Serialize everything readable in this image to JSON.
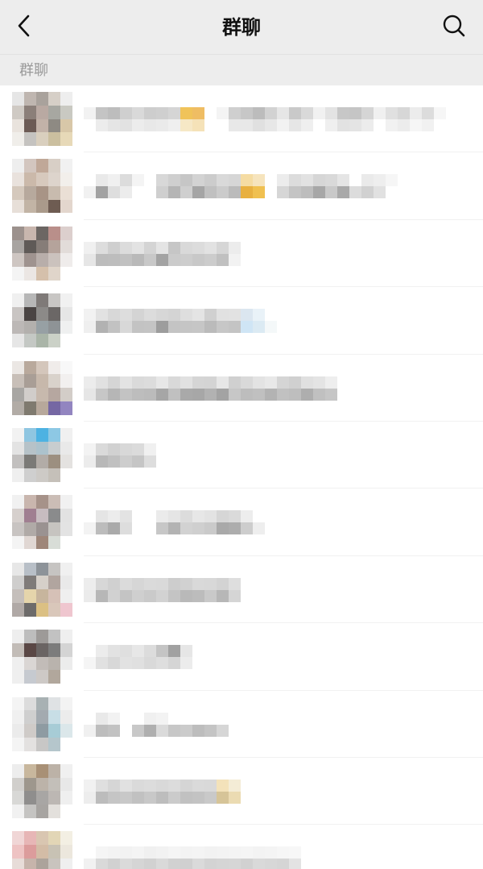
{
  "navbar": {
    "title": "群聊",
    "back_icon": "chevron-left-icon",
    "search_icon": "search-icon"
  },
  "section": {
    "label": "群聊"
  },
  "colors": {
    "navbar_bg": "#ededed",
    "list_bg": "#ffffff",
    "section_text": "#9a9a9a",
    "title_text": "#111111"
  },
  "groups": [
    {
      "avatar": [
        "#e6e6e6",
        "#bfb6b0",
        "#a9a29c",
        "#d6cfc7",
        "#eeeeee",
        "#cfcac4",
        "#8b7f79",
        "#b9a9a2",
        "#a7a7a1",
        "#c9c9c2",
        "#e9e3dd",
        "#6c5b55",
        "#c2b2a8",
        "#8e8a83",
        "#d8c7a8",
        "#f0eeea",
        "#c5c3c0",
        "#d9cfbe",
        "#cbbf9f",
        "#e7d9b8"
      ],
      "name_blocks": [
        [
          "#f2f2f2",
          "#c4c4c4",
          "#bdbdbd",
          "#cfcfcf",
          "#d9d9d9",
          "#cdcdcd",
          "#cfcfcf",
          "#d5d5d5",
          "#f0c35a",
          "#efbd63",
          "#ffffff",
          "#f4f4f4",
          "#cfcfcf",
          "#c7c7c7",
          "#bcbcbc",
          "#d2d2d2",
          "#e6e6e6",
          "#c9c9c9",
          "#d9d9d9",
          "#f1f1f1",
          "#e3e3e3",
          "#c7c7c7",
          "#c5c5c5",
          "#d5d5d5",
          "#f0f0f0",
          "#e0e0e0",
          "#d7d7d7",
          "#ececec",
          "#dcdcdc",
          "#f6f6f6"
        ],
        [
          "#ffffff",
          "#ececec",
          "#e5e5e5",
          "#e2e2e2",
          "#ececec",
          "#e8e8e8",
          "#eaeaea",
          "#efefef",
          "#f6e8c6",
          "#f5e2b8",
          "#ffffff",
          "#ffffff",
          "#e8e8e8",
          "#e8e8e8",
          "#e0e0e0",
          "#e7e7e7",
          "#f2f2f2",
          "#e6e6e6",
          "#efefef",
          "#ffffff",
          "#efefef",
          "#e2e2e2",
          "#e4e4e4",
          "#ececec",
          "#ffffff",
          "#f1f1f1",
          "#ececec",
          "#f6f6f6",
          "#f1f1f1",
          "#ffffff"
        ]
      ]
    },
    {
      "avatar": [
        "#eeeeee",
        "#d3c6bf",
        "#c0a898",
        "#d8cfc6",
        "#f1f1f1",
        "#e9e2dd",
        "#cbb9aa",
        "#d7c9bd",
        "#ddd4cc",
        "#f2efeb",
        "#d5c9bd",
        "#b7a99d",
        "#a89486",
        "#c8bbae",
        "#eadfd5",
        "#e7dfd8",
        "#c2b4a5",
        "#aa9a8b",
        "#6e5c52",
        "#e3d6cd"
      ],
      "name_blocks": [
        [
          "#ffffff",
          "#e9e9e9",
          "#f0f0f0",
          "#dcdcdc",
          "#f4f4f4",
          "#ffffff",
          "#d8d8d8",
          "#cfcfcf",
          "#c6c6c6",
          "#d3d3d3",
          "#cccccc",
          "#d9d9d9",
          "#d6d6d6",
          "#f5dca3",
          "#f6e4bd",
          "#ffffff",
          "#ececec",
          "#dcdcdc",
          "#e2e2e2",
          "#d6d6d6",
          "#d9d9d9",
          "#e5e5e5",
          "#ffffff",
          "#eaeaea",
          "#eeeeee",
          "#f6f6f6",
          "#ffffff",
          "#ffffff",
          "#ffffff",
          "#ffffff"
        ],
        [
          "#f1f1f1",
          "#a2a2a2",
          "#dedede",
          "#ececec",
          "#ffffff",
          "#ffffff",
          "#cfcfcf",
          "#b5b5b5",
          "#cfcfcf",
          "#a5a5a5",
          "#c0c0c0",
          "#cbcbcb",
          "#bbbbbb",
          "#e8b040",
          "#f0c050",
          "#ffffff",
          "#d6d6d6",
          "#c4c4c4",
          "#bdbdbd",
          "#a7a7a7",
          "#c9c9c9",
          "#a9a9a9",
          "#dcdcdc",
          "#d1d1d1",
          "#e1e1e1",
          "#ffffff",
          "#ffffff",
          "#ffffff",
          "#ffffff",
          "#ffffff"
        ]
      ]
    },
    {
      "avatar": [
        "#9c918d",
        "#c8b6ae",
        "#6c6663",
        "#b98f8a",
        "#dccfcd",
        "#a8a4a1",
        "#5f5a57",
        "#867d78",
        "#b5a39b",
        "#e2dcd9",
        "#cec6c2",
        "#9f938f",
        "#b8aeaa",
        "#cbc2bd",
        "#efeceb",
        "#f4f4f4",
        "#ebe6e3",
        "#d5c0ab",
        "#e0d5ca",
        "#ffffff"
      ],
      "name_blocks": [
        [
          "#f0f0f0",
          "#dddddd",
          "#cfcfcf",
          "#dcdcdc",
          "#e3e3e3",
          "#d4d4d4",
          "#e4e4e4",
          "#c6c6c6",
          "#d9d9d9",
          "#dcdcdc",
          "#e2e2e2",
          "#d6d6d6",
          "#ececec",
          "#ffffff"
        ],
        [
          "#e6e6e6",
          "#bcbcbc",
          "#bdbdbd",
          "#c1c1c1",
          "#b9b9b9",
          "#c8c8c8",
          "#a3a3a3",
          "#cbcbcb",
          "#cdcdcd",
          "#c8c8c8",
          "#cccccc",
          "#c0c0c0",
          "#f2f2f2",
          "#ffffff"
        ]
      ]
    },
    {
      "avatar": [
        "#f0f0f0",
        "#b7b7b7",
        "#7f7a78",
        "#c8c6c4",
        "#f1f1f1",
        "#c9c5c3",
        "#4a4443",
        "#8c8a88",
        "#6b6766",
        "#e6e6e6",
        "#bcb8b6",
        "#b3b0ad",
        "#97a0a4",
        "#8e9396",
        "#eff0f0",
        "#e6e6e6",
        "#c4c8c4",
        "#aab5a8",
        "#cbd1c7",
        "#ffffff"
      ],
      "name_blocks": [
        [
          "#f2f2f2",
          "#e2e2e2",
          "#d8d8d8",
          "#dddddd",
          "#d4d4d4",
          "#dcdcdc",
          "#d7d7d7",
          "#d4d4d4",
          "#dedede",
          "#e4e4e4",
          "#d0d0d0",
          "#e1e1e1",
          "#e2e2e2",
          "#dbe6f0",
          "#e9f2f8",
          "#ffffff"
        ],
        [
          "#efefef",
          "#b2b2b2",
          "#c2c2c2",
          "#d8d8d8",
          "#c3c3c3",
          "#c4c4c4",
          "#9d9d9d",
          "#c4c4c4",
          "#c5c5c5",
          "#c6c6c6",
          "#bbbbbb",
          "#c7c7c7",
          "#c4c4c4",
          "#cfe5f5",
          "#dbeaf3",
          "#f4f8f9"
        ]
      ]
    },
    {
      "avatar": [
        "#ebe7e4",
        "#b9a99c",
        "#d4c6bb",
        "#f0ecea",
        "#f8f8f8",
        "#c8bfb8",
        "#a99e96",
        "#c7b8ab",
        "#d9d2cb",
        "#f2f0ef",
        "#a8a6a3",
        "#d1cdca",
        "#c7b9ad",
        "#b6a7a0",
        "#d3cdc8",
        "#b2aca6",
        "#7f7a6f",
        "#b7a89b",
        "#7567a3",
        "#9285c0"
      ],
      "name_blocks": [
        [
          "#ececec",
          "#e1e1e1",
          "#d5d5d5",
          "#e3e3e3",
          "#dadada",
          "#dcdcdc",
          "#e7e7e7",
          "#d9d9d9",
          "#e1e1e1",
          "#d5d5d5",
          "#d4d4d4",
          "#e7e7e7",
          "#d0d0d0",
          "#d9d9d9",
          "#e3e3e3",
          "#e8e8e8",
          "#d5d5d5",
          "#d0d0d0",
          "#e0e0e0",
          "#e4e4e4",
          "#eeeeee"
        ],
        [
          "#e6e6e6",
          "#c7c7c7",
          "#b6b6b6",
          "#c3c3c3",
          "#bdbdbd",
          "#bbbbbb",
          "#a6a6a6",
          "#c0c0c0",
          "#a9a9a9",
          "#a7a7a7",
          "#b2b2b2",
          "#a3a3a3",
          "#c7c7c7",
          "#bdbdbd",
          "#c0c0c0",
          "#b3b3b3",
          "#c1c1c1",
          "#bebebe",
          "#aeaeae",
          "#c0c0c0",
          "#c6c6c6"
        ]
      ]
    },
    {
      "avatar": [
        "#f2f2f2",
        "#8fc6e1",
        "#4db2e2",
        "#8dc8e4",
        "#f0f0f0",
        "#e3e3e3",
        "#b6c2c8",
        "#acc2cc",
        "#c8cdcf",
        "#e9e9e9",
        "#c2c0bf",
        "#7b7a77",
        "#b2aca7",
        "#9c8f80",
        "#e4e2e0",
        "#efefef",
        "#cfcfcf",
        "#cdcac6",
        "#c5c0b9",
        "#ffffff"
      ],
      "name_blocks": [
        [
          "#f3f3f3",
          "#dadada",
          "#d1d1d1",
          "#d8d8d8",
          "#dbdbdb",
          "#f0f0f0"
        ],
        [
          "#ececec",
          "#b8b8b8",
          "#c0c0c0",
          "#cdcdcd",
          "#c5c5c5",
          "#dddddd"
        ]
      ]
    },
    {
      "avatar": [
        "#f1f1f1",
        "#c9b6ae",
        "#a69289",
        "#cbbdb6",
        "#f1f1f1",
        "#d6d0cd",
        "#a07f91",
        "#c7bcc0",
        "#8a8b8c",
        "#e2e2e2",
        "#c8c4c2",
        "#b0aaa7",
        "#9a9291",
        "#c6c4c0",
        "#e3e3e3",
        "#f4f4f4",
        "#e0d7d3",
        "#9e8679",
        "#d8ddd7",
        "#ffffff"
      ],
      "name_blocks": [
        [
          "#ffffff",
          "#e5e5e5",
          "#ececec",
          "#e3e3e3",
          "#ffffff",
          "#ffffff",
          "#ebebeb",
          "#e5e5e5",
          "#dcdcdc",
          "#e7e7e7",
          "#e3e3e3",
          "#d6d6d6",
          "#dadada",
          "#ededed",
          "#ffffff"
        ],
        [
          "#f3f3f3",
          "#bcbcbc",
          "#aaaaaa",
          "#dddddd",
          "#ffffff",
          "#ffffff",
          "#c7c7c7",
          "#b3b3b3",
          "#d2d2d2",
          "#cfcfcf",
          "#cacaca",
          "#a9a9a9",
          "#adadad",
          "#cdcdcd",
          "#eeeeee"
        ]
      ]
    },
    {
      "avatar": [
        "#e7e7e7",
        "#b8bfc7",
        "#8d9399",
        "#c6c4c2",
        "#f0f0f0",
        "#cfcecd",
        "#7f7b79",
        "#d6d0c9",
        "#b1a59f",
        "#e9e9e9",
        "#c5bfbb",
        "#e5d5ab",
        "#c7b59d",
        "#d6c1b7",
        "#efefef",
        "#b0a9a6",
        "#6d6b6a",
        "#dbc083",
        "#d9c7ba",
        "#efc6cf"
      ],
      "name_blocks": [
        [
          "#ededed",
          "#d7d7d7",
          "#d0d0d0",
          "#dbdbdb",
          "#d6d6d6",
          "#dadada",
          "#d9d9d9",
          "#cdcdcd",
          "#d1d1d1",
          "#d9d9d9",
          "#d8d8d8",
          "#d3d3d3",
          "#dedede"
        ],
        [
          "#ebebeb",
          "#b7b7b7",
          "#d1d1d1",
          "#c4c4c4",
          "#cfcfcf",
          "#cacaca",
          "#d2d2d2",
          "#c4c4c4",
          "#b9b9b9",
          "#bcbcbc",
          "#c9c9c9",
          "#b7b7b7",
          "#d5d5d5"
        ]
      ]
    },
    {
      "avatar": [
        "#eeeeee",
        "#bdbdbd",
        "#9d9a98",
        "#c2c2c2",
        "#efefef",
        "#c2bcb7",
        "#5a4745",
        "#6a6463",
        "#7c7c7c",
        "#d4d4d4",
        "#efefef",
        "#dad6d4",
        "#c2bcb8",
        "#b9b3ad",
        "#ececec",
        "#efefef",
        "#c6cad0",
        "#cdc9c6",
        "#b1a79c",
        "#ffffff"
      ],
      "name_blocks": [
        [
          "#ffffff",
          "#ececec",
          "#e2e2e2",
          "#dfdfdf",
          "#e7e7e7",
          "#dcdcdc",
          "#c4c4c4",
          "#a1a1a1",
          "#e6e6e6"
        ],
        [
          "#f5f5f5",
          "#e1e1e1",
          "#d8d8d8",
          "#e2e2e2",
          "#e0e0e0",
          "#d9d9d9",
          "#dedede",
          "#d5d5d5",
          "#ececec"
        ]
      ]
    },
    {
      "avatar": [
        "#f4f4f4",
        "#dcdcdc",
        "#a8b1b3",
        "#dfe2e4",
        "#f3f3f3",
        "#f0f0f0",
        "#cfcfcf",
        "#a3aab0",
        "#c8dee6",
        "#ececec",
        "#ebebeb",
        "#cfcbc8",
        "#8e9ba2",
        "#a7ccd6",
        "#dbe7ea",
        "#f4f4f4",
        "#e3e1e0",
        "#c8c7c6",
        "#b5c6cc",
        "#ffffff"
      ],
      "name_blocks": [
        [
          "#ffffff",
          "#e9e9e9",
          "#f2f2f2",
          "#ffffff",
          "#ffffff",
          "#f0f0f0",
          "#f3f3f3",
          "#ffffff",
          "#ffffff",
          "#ffffff",
          "#ffffff",
          "#ffffff"
        ],
        [
          "#f0f0f0",
          "#bdbdbd",
          "#c2c2c2",
          "#ffffff",
          "#c8c8c8",
          "#afafaf",
          "#dadada",
          "#c7c7c7",
          "#cbcbcb",
          "#bdbdbd",
          "#c4c4c4",
          "#d6d6d6"
        ]
      ]
    },
    {
      "avatar": [
        "#ededed",
        "#c8b79d",
        "#a89076",
        "#bcb2a7",
        "#f0f0f0",
        "#d1cfcc",
        "#9e978d",
        "#bcb3a9",
        "#c3bfb9",
        "#e8e8e8",
        "#d8d8d6",
        "#8f8e8d",
        "#a8a6a4",
        "#bcb7b3",
        "#efefef",
        "#f1f1f1",
        "#c5c4c2",
        "#a7a4a1",
        "#e3e0dc",
        "#ffffff"
      ],
      "name_blocks": [
        [
          "#f1f1f1",
          "#dfdfdf",
          "#d6d6d6",
          "#e1e1e1",
          "#dadada",
          "#dcdcdc",
          "#d9d9d9",
          "#dcdcdc",
          "#d5d5d5",
          "#dadada",
          "#d9d9d9",
          "#f3e2ba",
          "#f4ecd6"
        ],
        [
          "#ededed",
          "#bcbcbc",
          "#c5c5c5",
          "#c8c8c8",
          "#c1c1c1",
          "#c8c8c8",
          "#bdbdbd",
          "#cbcbcb",
          "#c1c1c1",
          "#c3c3c3",
          "#c9c9c9",
          "#d6c498",
          "#ebdbb2"
        ]
      ]
    },
    {
      "avatar": [
        "#f0d6d6",
        "#e7b6b6",
        "#d9c6b1",
        "#e2d6b6",
        "#f3efe3",
        "#eec3c3",
        "#dc9c9c",
        "#d3bca6",
        "#c8c2b4",
        "#ece7dd",
        "#e7dcd8",
        "#c6b4ab",
        "#aca39b",
        "#c9c4be",
        "#efefef",
        "#ffffff",
        "#f6f1ee",
        "#efe8e2",
        "#f5f2ee",
        "#ffffff"
      ],
      "name_blocks": [
        [
          "#ffffff",
          "#f5f5f5",
          "#f3f3f3",
          "#f2f2f2",
          "#f4f4f4",
          "#f0f0f0",
          "#f2f2f2",
          "#f5f5f5",
          "#f3f3f3",
          "#f4f4f4",
          "#f2f2f2",
          "#f3f3f3",
          "#f4f4f4",
          "#f5f5f5",
          "#f3f3f3",
          "#f4f4f4",
          "#f6f6f6",
          "#f7f7f7"
        ],
        [
          "#f1f1f1",
          "#d9d9d9",
          "#d1d1d1",
          "#dadada",
          "#d5d5d5",
          "#d1d1d1",
          "#d9d9d9",
          "#d1d1d1",
          "#d0d0d0",
          "#dadada",
          "#d3d3d3",
          "#d5d5d5",
          "#d6d6d6",
          "#d1d1d1",
          "#d9d9d9",
          "#d7d7d7",
          "#d5d5d5",
          "#e3e3e3"
        ]
      ]
    }
  ]
}
